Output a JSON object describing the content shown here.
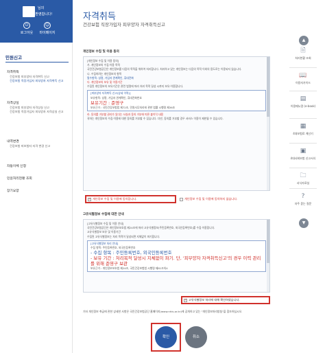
{
  "user": {
    "name": "님의",
    "greeting": "방문을 환영합니다!",
    "logout_label": "로그아웃",
    "mypage_label": "마이페이지"
  },
  "sidebar": {
    "title": "민원신고",
    "groups": [
      {
        "label": "자격취득",
        "items": [
          "건강보험 피부양자 자격취득 신고",
          "건강보험 직장가입자 피부양자 자격취득 신고"
        ]
      },
      {
        "label": "자격상실",
        "items": [
          "건강보험 피부양자 자격상실 신고",
          "건강보험 직장가입자 피부양자 자격상실 신고"
        ]
      },
      {
        "label": "내역변경",
        "items": [
          "건강보험 피보험자 자격 변경 신고"
        ]
      },
      {
        "label": "자동이체 신청",
        "items": []
      },
      {
        "label": "민원처리현황 조회",
        "items": []
      },
      {
        "label": "장기요양",
        "items": []
      }
    ]
  },
  "header": {
    "title": "자격취득",
    "subtitle": "건강보험 직장가입자 피부양자 자격취득신고"
  },
  "consent1": {
    "heading": "개인정보 수집 및 이용 동의",
    "lines": [
      "[개인정보 수집 및 이용 동의]",
      "가. 개인정보의 수집·이용 목적",
      "국민건강보험공단은 개인정보를 다음의 목적을 위하여 처리합니다. 처리하고 있는 개인정보는 다음의 목적 이외의 용도로는 이용되지 않습니다.",
      "나. 수집하려는 개인정보의 항목",
      "필수항목: 성명, 가입자 관계확인, 휴대전화",
      "다. 개인정보의 보유 및 이용기간",
      "수집된 개인정보의 보유기간은 관련 법령에 따라 처리 목적 달성 시까지 보유·이용합니다."
    ],
    "box_title": "[피부양자 자격취득 신고(상세 이력)]",
    "box_line1": "보유항목: 성명, 가입자 관계확인, 휴대전화번호",
    "box_big": "보유기간 : 준영구",
    "box_line2": "보유근거 : 국민건강보험법 제72조, 민원사무처리에 관한 법률 시행령 제36조",
    "refuse_title": "라. 동의를 거부할 권리가 있다는 사실과 동의 거부에 따른 불이익 내용",
    "refuse_text": "귀하는 개인정보의 수집·이용에 대한 동의를 거부할 수 있습니다. 다만, 동의를 거부할 경우 서비스 이용이 제한될 수 있습니다."
  },
  "agree1": {
    "yes": "개인정보 수집 및 이용에 동의합니다.",
    "no": "개인정보 수집 및 이용에 동의하지 않습니다."
  },
  "consent2": {
    "heading": "고유식별정보 수집에 대한 안내",
    "lines": [
      "[고유식별정보 수집 및 이용 안내]",
      "국민건강보험공단은 개인정보보호법 제24조에 따라 고유식별정보(주민등록번호, 외국인등록번호)를 수집·이용합니다.",
      "고유식별정보 보유 및 이용기간",
      "수집된 고유식별정보는 처리 목적이 달성되면 지체없이 파기합니다."
    ],
    "box_title": "[고유식별정보 처리 안내]",
    "box_line1": "수집 항목: 주민등록번호, 외국인등록번호",
    "box_big": "- 수집 항목 : 주민등록번호, 외국인등록번호",
    "box_big2": "- 보유 기간 : 처리목적 달성시 지체없이 파기. 단, '피부양자 자격취득신고'의 경우 이력 관리를 위해 준영구 보관",
    "box_line2": "보유근거 : 개인정보보호법 제24조, 국민건강보험법 시행령 제81조의4"
  },
  "agree2": {
    "yes": "고유식별정보 처리에 대해 확인하였습니다."
  },
  "note": "기타 개인정보 취급에 관한 상세한 사항은 국민건강보험공단 홈페이지(www.nhis.or.kr)에 공개하고 있는 \"개인정보처리방침\"을 참조하십시오.",
  "buttons": {
    "confirm": "확인",
    "cancel": "취소"
  },
  "quickmenu": [
    {
      "label": "처리현황 조회",
      "icon": "document-search-icon"
    },
    {
      "label": "이용자가이드",
      "icon": "guide-book-icon"
    },
    {
      "label": "이용매뉴얼 (e-book)",
      "icon": "ebook-icon"
    },
    {
      "label": "4대보험료 계산기",
      "icon": "calculator-icon"
    },
    {
      "label": "4대사회보험 신고서식",
      "icon": "form-icon"
    },
    {
      "label": "서식자료실",
      "icon": "folder-icon"
    },
    {
      "label": "자주 묻는 질문",
      "icon": "question-icon"
    }
  ],
  "colors": {
    "brand": "#2a5aa6",
    "highlight": "#d0302b"
  }
}
